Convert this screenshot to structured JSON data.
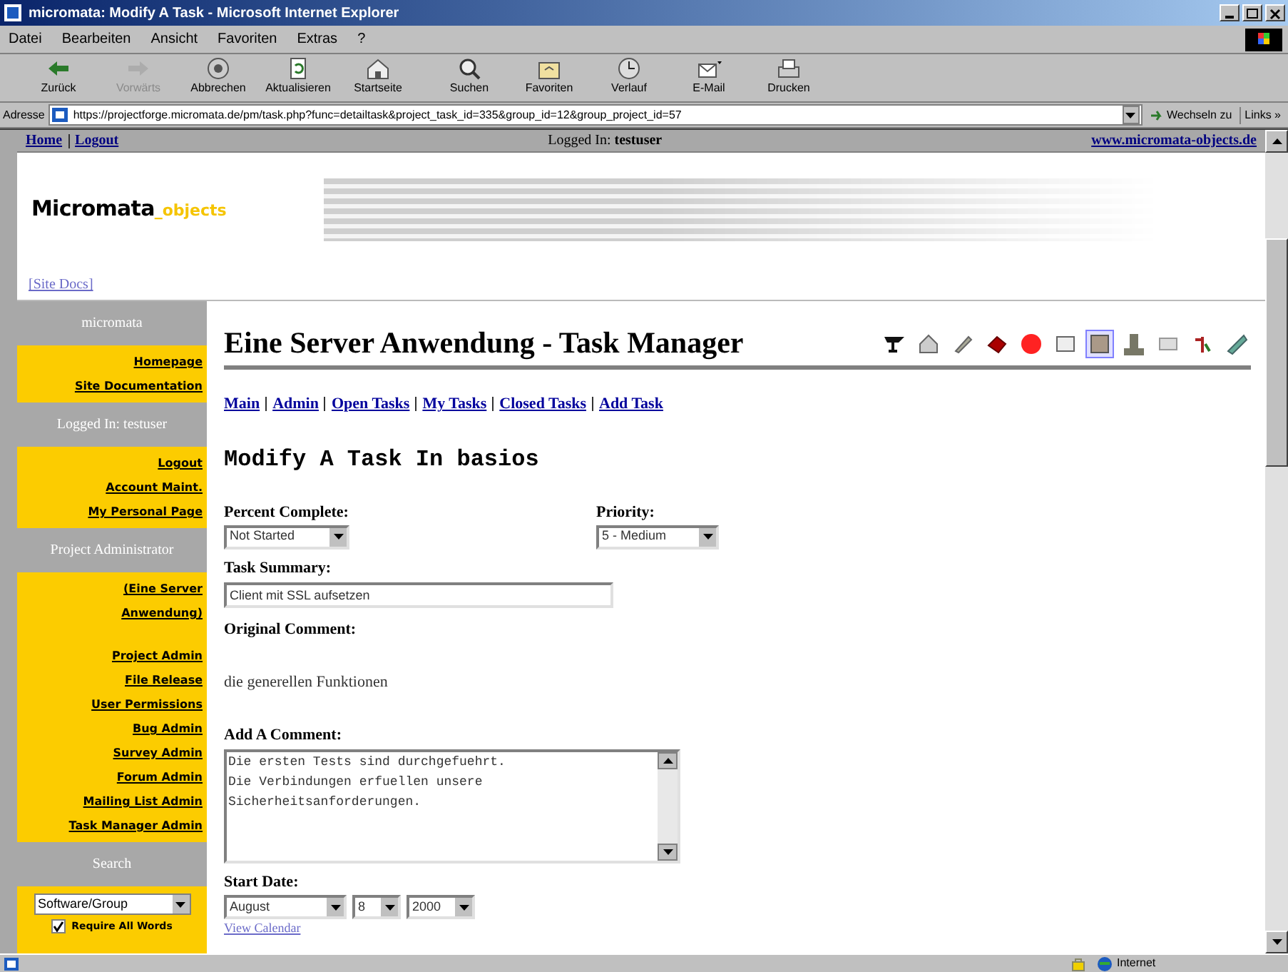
{
  "window": {
    "title": "micromata: Modify A Task - Microsoft Internet Explorer"
  },
  "menu": [
    "Datei",
    "Bearbeiten",
    "Ansicht",
    "Favoriten",
    "Extras",
    "?"
  ],
  "toolbar": [
    {
      "label": "Zurück",
      "kind": "back",
      "disabled": false
    },
    {
      "label": "Vorwärts",
      "kind": "forward",
      "disabled": true
    },
    {
      "label": "Abbrechen",
      "kind": "stop",
      "disabled": false
    },
    {
      "label": "Aktualisieren",
      "kind": "refresh",
      "disabled": false
    },
    {
      "label": "Startseite",
      "kind": "home",
      "disabled": false
    },
    {
      "label": "Suchen",
      "kind": "search",
      "disabled": false
    },
    {
      "label": "Favoriten",
      "kind": "favorites",
      "disabled": false
    },
    {
      "label": "Verlauf",
      "kind": "history",
      "disabled": false
    },
    {
      "label": "E-Mail",
      "kind": "mail",
      "disabled": false
    },
    {
      "label": "Drucken",
      "kind": "print",
      "disabled": false
    }
  ],
  "address_bar": {
    "label": "Adresse",
    "url": "https://projectforge.micromata.de/pm/task.php?func=detailtask&project_task_id=335&group_id=12&group_project_id=57",
    "go": "Wechseln zu",
    "links": "Links »"
  },
  "top_bar": {
    "links": [
      "Home",
      "Logout"
    ],
    "logged_in_label": "Logged In:",
    "user": "testuser",
    "site_link": "www.micromata-objects.de"
  },
  "logo": {
    "part_1": "Micromata",
    "part_2": "_objects"
  },
  "site_docs": "[Site Docs]",
  "sidebar": [
    {
      "kind": "header",
      "text": "micromata"
    },
    {
      "kind": "links",
      "items": [
        "Homepage",
        "Site Documentation"
      ]
    },
    {
      "kind": "header",
      "text": "Logged In: testuser"
    },
    {
      "kind": "links",
      "items": [
        "Logout",
        "Account Maint.",
        "My Personal Page"
      ]
    },
    {
      "kind": "header",
      "text": "Project Administrator"
    },
    {
      "kind": "links",
      "items": [
        "(Eine Server Anwendung)"
      ]
    },
    {
      "kind": "links",
      "items": [
        "Project Admin",
        "File Release",
        "User Permissions",
        "Bug Admin",
        "Survey Admin",
        "Forum Admin",
        "Mailing List Admin",
        "Task Manager Admin"
      ]
    },
    {
      "kind": "header",
      "text": "Search"
    },
    {
      "kind": "search",
      "select": "Software/Group",
      "checkbox_label": "Require All Words",
      "checked": true
    }
  ],
  "page_title": "Eine Server Anwendung - Task Manager",
  "tool_icons": [
    {
      "selected": false
    },
    {
      "selected": false
    },
    {
      "selected": false
    },
    {
      "selected": false
    },
    {
      "selected": false
    },
    {
      "selected": false
    },
    {
      "selected": true
    },
    {
      "selected": false
    },
    {
      "selected": false
    },
    {
      "selected": false
    },
    {
      "selected": false
    }
  ],
  "nav_links": [
    "Main",
    "Admin",
    "Open Tasks",
    "My Tasks",
    "Closed Tasks",
    "Add Task"
  ],
  "form_title": "Modify A Task In basios",
  "percent_complete": {
    "label": "Percent Complete:",
    "value": "Not Started"
  },
  "priority": {
    "label": "Priority:",
    "value": "5 - Medium"
  },
  "task_summary": {
    "label": "Task Summary:",
    "value": "Client mit SSL aufsetzen"
  },
  "original_comment": {
    "label": "Original Comment:",
    "text": "die generellen Funktionen"
  },
  "add_comment": {
    "label": "Add A Comment:",
    "value": "Die ersten Tests sind durchgefuehrt.\nDie Verbindungen erfuellen unsere\nSicherheitsanforderungen."
  },
  "start_date": {
    "label": "Start Date:",
    "month": "August",
    "day": "8",
    "year": "2000",
    "calendar_link": "View Calendar"
  },
  "status_bar": {
    "zone": "Internet"
  }
}
